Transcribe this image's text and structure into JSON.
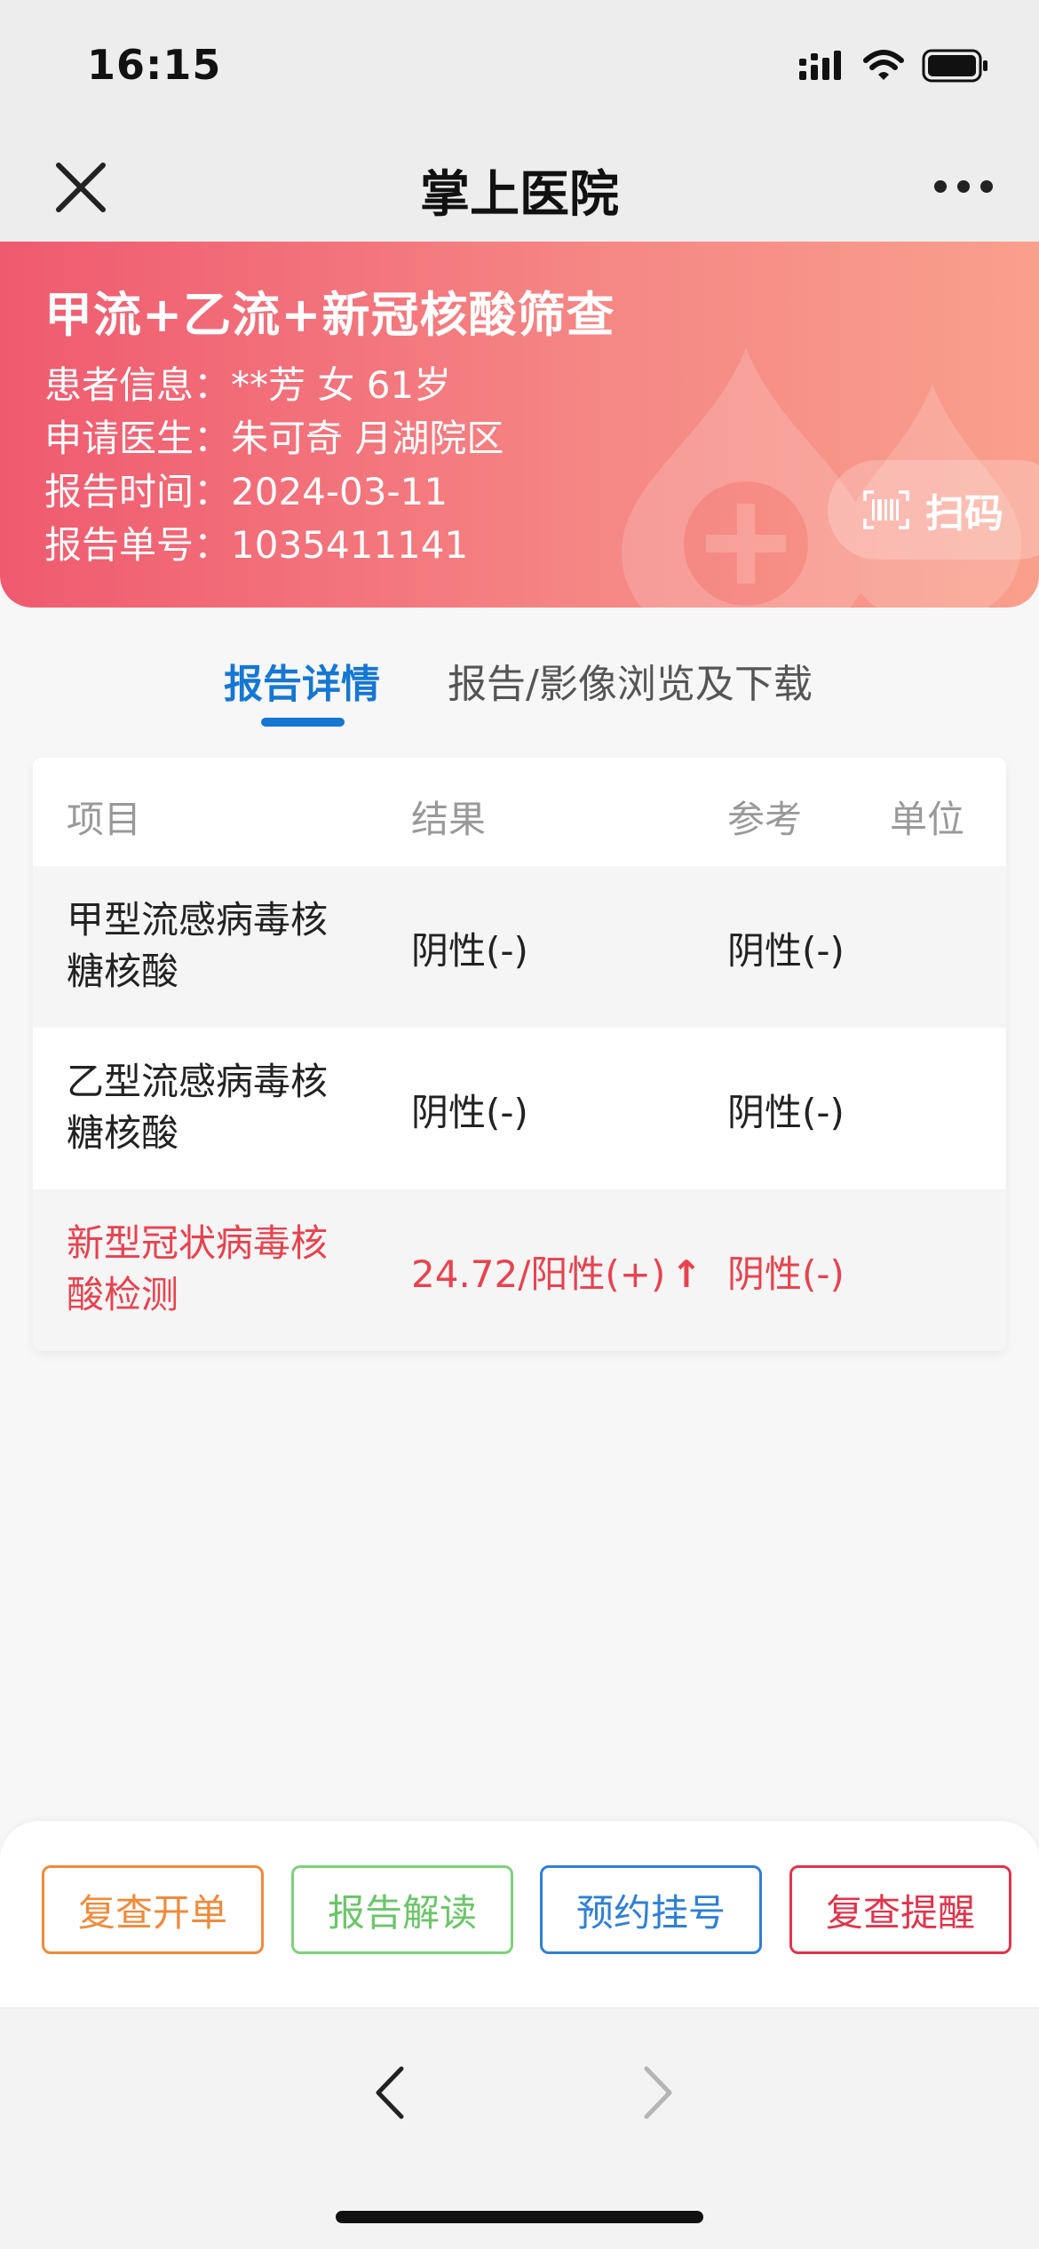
{
  "status_bar": {
    "time": "16:15"
  },
  "nav": {
    "title": "掌上医院"
  },
  "report": {
    "title": "甲流+乙流+新冠核酸筛查",
    "patient_info": "患者信息：**芳 女 61岁",
    "doctor": "申请医生：朱可奇 月湖院区",
    "report_time": "报告时间：2024-03-11",
    "report_no": "报告单号：1035411141",
    "scan_label": "扫码",
    "colors": {
      "gradient_start": "#ef5a6f",
      "gradient_end": "#f9a08c"
    }
  },
  "tabs": [
    {
      "label": "报告详情",
      "active": true
    },
    {
      "label": "报告/影像浏览及下载",
      "active": false
    }
  ],
  "table": {
    "headers": {
      "item": "项目",
      "result": "结果",
      "reference": "参考",
      "unit": "单位"
    },
    "rows": [
      {
        "item_line1": "甲型流感病毒核",
        "item_line2": "糖核酸",
        "result": "阴性(-)",
        "reference": "阴性(-)",
        "abnormal": false
      },
      {
        "item_line1": "乙型流感病毒核",
        "item_line2": "糖核酸",
        "result": "阴性(-)",
        "reference": "阴性(-)",
        "abnormal": false
      },
      {
        "item_line1": "新型冠状病毒核",
        "item_line2": "酸检测",
        "result": "24.72/阳性(+)",
        "arrow": "↑",
        "reference": "阴性(-)",
        "abnormal": true
      }
    ],
    "abnormal_color": "#e8424e"
  },
  "actions": {
    "recheck_order": "复查开单",
    "report_interpret": "报告解读",
    "appointment": "预约挂号",
    "recheck_reminder": "复查提醒"
  },
  "accent": "#1677d2"
}
